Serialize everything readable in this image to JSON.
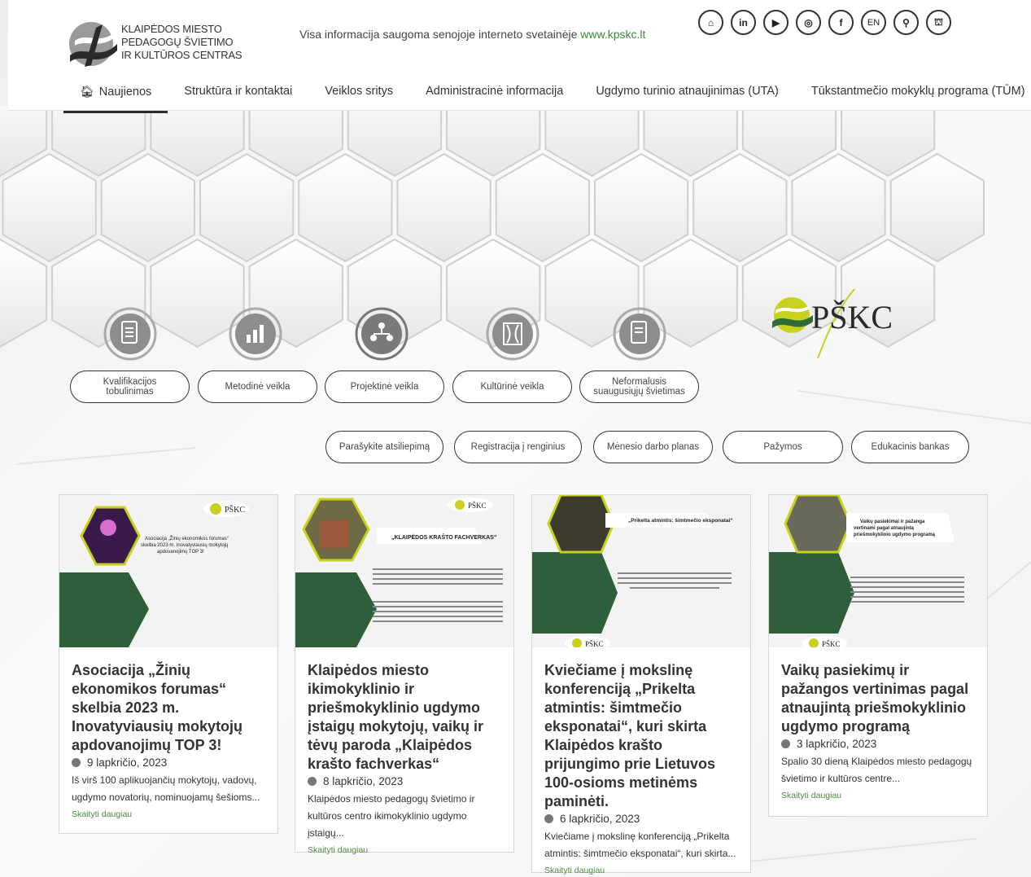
{
  "header": {
    "logo_lines": [
      "KLAIPĖDOS MIESTO",
      "PEDAGOGŲ ŠVIETIMO",
      "IR KULTŪROS CENTRAS"
    ],
    "notice_text": "Visa informacija saugoma senojoje interneto svetainėje ",
    "notice_link": "www.kpskc.lt",
    "social_icons": [
      "building-icon",
      "linkedin-icon",
      "youtube-icon",
      "instagram-icon",
      "facebook-icon",
      "en-language-icon",
      "search-icon",
      "sitemap-icon"
    ],
    "social_glyphs": [
      "⌂",
      "in",
      "▶",
      "◎",
      "f",
      "EN",
      "⚲",
      "⛫"
    ]
  },
  "nav": {
    "items": [
      "Naujienos",
      "Struktūra ir kontaktai",
      "Veiklos sritys",
      "Administracinė informacija",
      "Ugdymo turinio atnaujinimas (UTA)",
      "Tūkstantmečio mokyklų programa (TŪM)"
    ]
  },
  "activity_buttons": [
    "Kvalifikacijos tobulinimas",
    "Metodinė veikla",
    "Projektinė veikla",
    "Kultūrinė veikla",
    "Neformalusis suaugusiųjų švietimas"
  ],
  "quick_links": [
    "Parašykite atsiliepimą",
    "Registracija į renginius",
    "Mėnesio darbo planas",
    "Pažymos",
    "Edukacinis bankas"
  ],
  "pskc_logo_text": "PŠKC",
  "cards": [
    {
      "title": "Asociacija „Žinių ekonomikos forumas“ skelbia 2023 m. Inovatyviausių mokytojų apdovanojimų TOP 3!",
      "date": "9 lapkričio, 2023",
      "excerpt": "Iš virš 100 aplikuojančių mokytojų, vadovų, ugdymo novatorių, nominuojamų šešioms...",
      "more": "Skaityti daugiau",
      "img_text": "Asociacija „Žinių ekonomikos forumas“ skelbia 2023 m. Inovatyviausių mokytojų apdovanojimų TOP 3!"
    },
    {
      "title": "Klaipėdos miesto ikimokyklinio ir priešmokyklinio ugdymo įstaigų mokytojų, vaikų ir tėvų paroda „Klaipėdos krašto fachverkas“",
      "date": "8 lapkričio, 2023",
      "excerpt": "Klaipėdos miesto pedagogų švietimo ir kultūros centro ikimokyklinio ugdymo įstaigų...",
      "more": "Skaityti daugiau",
      "img_text": "„KLAIPĖDOS KRAŠTO FACHVERKAS“"
    },
    {
      "title": "Kviečiame į mokslinę konferenciją „Prikelta atmintis: šimtmečio eksponatai“, kuri skirta Klaipėdos krašto prijungimo prie Lietuvos 100-osioms metinėms paminėti.",
      "date": "6 lapkričio, 2023",
      "excerpt": "Kviečiame į mokslinę konferenciją „Prikelta atmintis: šimtmečio eksponatai“, kuri skirta...",
      "more": "Skaityti daugiau",
      "img_text": "„Prikelta atmintis: šimtmečio eksponatai“"
    },
    {
      "title": "Vaikų pasiekimų ir pažangos vertinimas pagal atnaujintą priešmokyklinio ugdymo programą",
      "date": "3 lapkričio, 2023",
      "excerpt": "Spalio 30 dieną Klaipėdos miesto pedagogų švietimo ir kultūros centre...",
      "more": "Skaityti daugiau",
      "img_text": "Vaikų pasiekimai ir pažanga vertinami pagal atnaujintą priešmokyklinio ugdymo programą"
    }
  ],
  "colors": {
    "brand_green": "#2f6b3a",
    "accent_yellow": "#c8d21e",
    "link_green": "#4b8a3f"
  }
}
